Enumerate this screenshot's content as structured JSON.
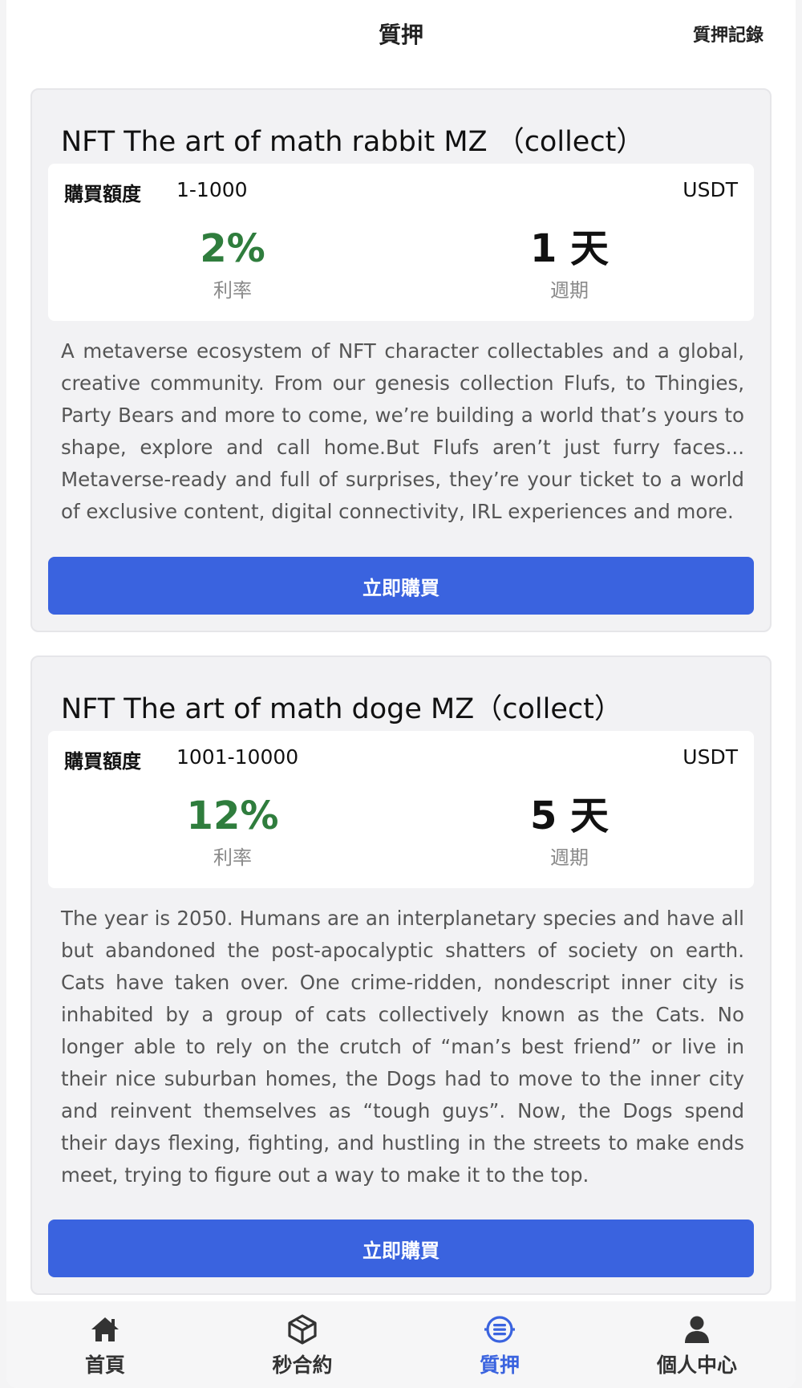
{
  "header": {
    "title": "質押",
    "record_link": "質押記錄"
  },
  "products": [
    {
      "title": "NFT The art of math rabbit MZ （collect）",
      "amount_label": "購買額度",
      "amount_range": "1-1000",
      "currency": "USDT",
      "rate": "2%",
      "rate_label": "利率",
      "period": "1 天",
      "period_label": "週期",
      "description": "A metaverse ecosystem of NFT character collectables and a global, creative community. From our genesis collection Flufs, to Thingies, Party Bears and more to come, we’re building a world that’s yours to shape, explore and call home.But Flufs aren’t just furry faces... Metaverse-ready and full of surprises, they’re your ticket to a world of exclusive content, digital connectivity, IRL experiences and more.",
      "buy_label": "立即購買"
    },
    {
      "title": "NFT The art of math doge MZ（collect）",
      "amount_label": "購買額度",
      "amount_range": "1001-10000",
      "currency": "USDT",
      "rate": "12%",
      "rate_label": "利率",
      "period": "5 天",
      "period_label": "週期",
      "description": "The year is 2050. Humans are an interplanetary species and have all but abandoned the post-apocalyptic shatters of society on earth. Cats have taken over. One crime-ridden, nondescript inner city is inhabited by a group of cats collectively known as the Cats. No longer able to rely on the crutch of “man’s best friend” or live in their nice suburban homes, the Dogs had to move to the inner city and reinvent themselves as “tough guys”. Now, the Dogs spend their days flexing, fighting, and hustling in the streets to make ends meet, trying to figure out a way to make it to the top.",
      "buy_label": "立即購買"
    }
  ],
  "tabbar": {
    "items": [
      {
        "label": "首頁",
        "icon": "home-icon"
      },
      {
        "label": "秒合約",
        "icon": "cube-icon"
      },
      {
        "label": "質押",
        "icon": "stake-icon"
      },
      {
        "label": "個人中心",
        "icon": "user-icon"
      }
    ],
    "active_index": 2
  },
  "colors": {
    "accent": "#3a63df",
    "rate_green": "#2f7d3d"
  }
}
